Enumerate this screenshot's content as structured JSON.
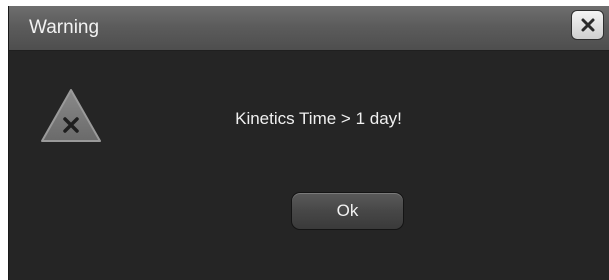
{
  "dialog": {
    "title": "Warning",
    "message": "Kinetics Time > 1 day!",
    "ok_label": "Ok",
    "icons": {
      "close": "close-icon",
      "warning": "warning-triangle-icon"
    }
  },
  "colors": {
    "background": "#252525",
    "titlebar": "#5c5c5c",
    "text": "#f0f0f0"
  }
}
